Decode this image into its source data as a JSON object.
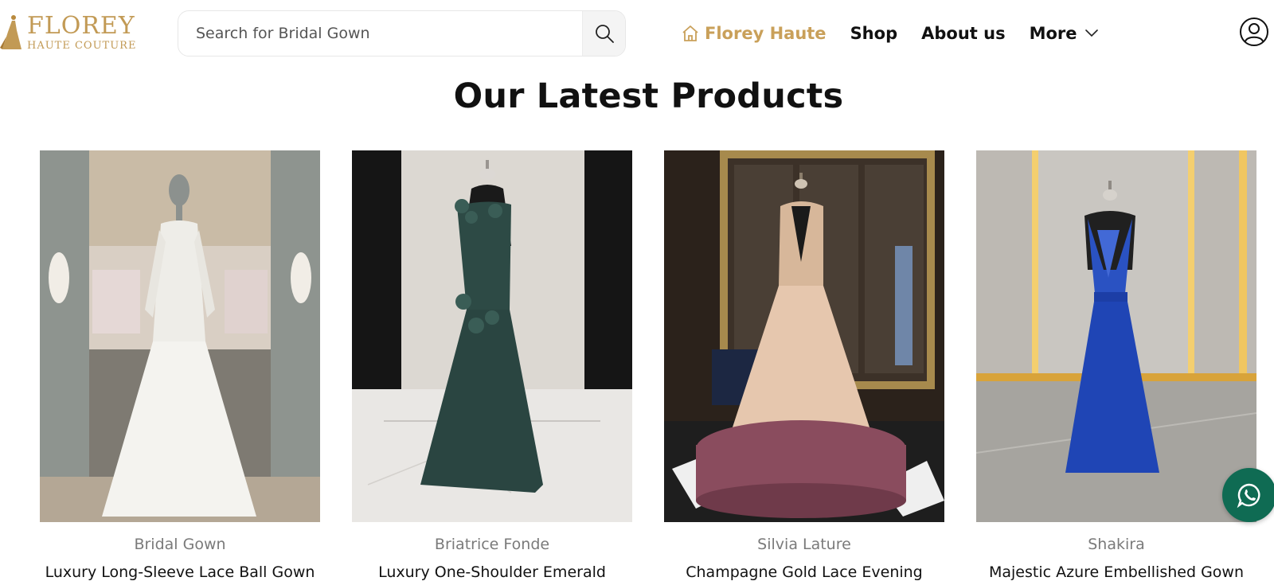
{
  "header": {
    "logo": {
      "title": "FLOREY",
      "subtitle": "HAUTE COUTURE"
    },
    "search": {
      "placeholder": "Search for Bridal Gown",
      "icon": "search-icon"
    },
    "nav": [
      {
        "label": "Florey Haute",
        "icon": "home-icon",
        "active": true
      },
      {
        "label": "Shop"
      },
      {
        "label": "About us"
      },
      {
        "label": "More",
        "icon": "chevron-down-icon"
      }
    ],
    "account_icon": "user-circle-icon"
  },
  "section": {
    "title": "Our Latest Products"
  },
  "products": [
    {
      "brand": "Bridal Gown",
      "name": "Luxury Long-Sleeve Lace Ball Gown",
      "dress_color": "#f1f0ec"
    },
    {
      "brand": "Briatrice Fonde",
      "name": "Luxury One-Shoulder Emerald",
      "dress_color": "#2d4a45"
    },
    {
      "brand": "Silvia Lature",
      "name": "Champagne Gold Lace Evening",
      "dress_color": "#e6c7ae"
    },
    {
      "brand": "Shakira",
      "name": "Majestic Azure Embellished Gown",
      "dress_color": "#1f45b5"
    }
  ],
  "colors": {
    "accent": "#c9a05a",
    "whatsapp": "#0f6b53"
  },
  "floating": {
    "icon": "whatsapp-icon"
  }
}
